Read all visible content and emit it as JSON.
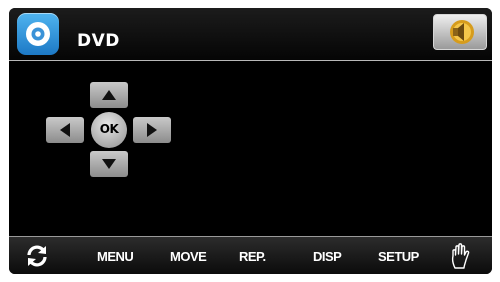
{
  "header": {
    "title": "DVD",
    "app_icon": "disc-icon",
    "sound_button_icon": "speaker-icon"
  },
  "dpad": {
    "up_icon": "arrow-up-icon",
    "down_icon": "arrow-down-icon",
    "left_icon": "arrow-left-icon",
    "right_icon": "arrow-right-icon",
    "ok_label": "OK"
  },
  "footer": {
    "refresh_icon": "refresh-icon",
    "items": [
      {
        "label": "MENU"
      },
      {
        "label": "MOVE"
      },
      {
        "label": "REP."
      },
      {
        "label": "DISP"
      },
      {
        "label": "SETUP"
      }
    ],
    "hand_icon": "hand-icon"
  },
  "colors": {
    "background": "#000000",
    "header_accent": "#2a8ad8",
    "button_gray": "#a9a9a9",
    "text": "#ffffff"
  }
}
